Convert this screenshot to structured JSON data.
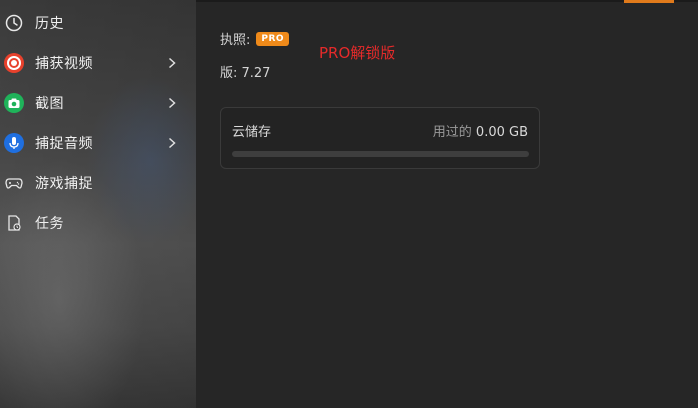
{
  "sidebar": {
    "items": [
      {
        "label": "历史",
        "icon": "clock-icon",
        "has_arrow": false
      },
      {
        "label": "捕获视频",
        "icon": "record-icon",
        "has_arrow": true
      },
      {
        "label": "截图",
        "icon": "camera-icon",
        "has_arrow": true
      },
      {
        "label": "捕捉音频",
        "icon": "microphone-icon",
        "has_arrow": true
      },
      {
        "label": "游戏捕捉",
        "icon": "gamepad-icon",
        "has_arrow": false
      },
      {
        "label": "任务",
        "icon": "task-icon",
        "has_arrow": false
      }
    ]
  },
  "main": {
    "license_label": "执照:",
    "license_badge": "PRO",
    "promo_text": "PRO解锁版",
    "version_text": "版: 7.27",
    "cloud": {
      "title": "云储存",
      "used_label": "用过的",
      "used_value": "0.00 GB",
      "used_fraction": 0
    }
  },
  "colors": {
    "accent": "#ef8a1a",
    "promo": "#e52a2a",
    "record": "#e8412c",
    "camera": "#1fb35a",
    "mic": "#1f6fe0"
  }
}
